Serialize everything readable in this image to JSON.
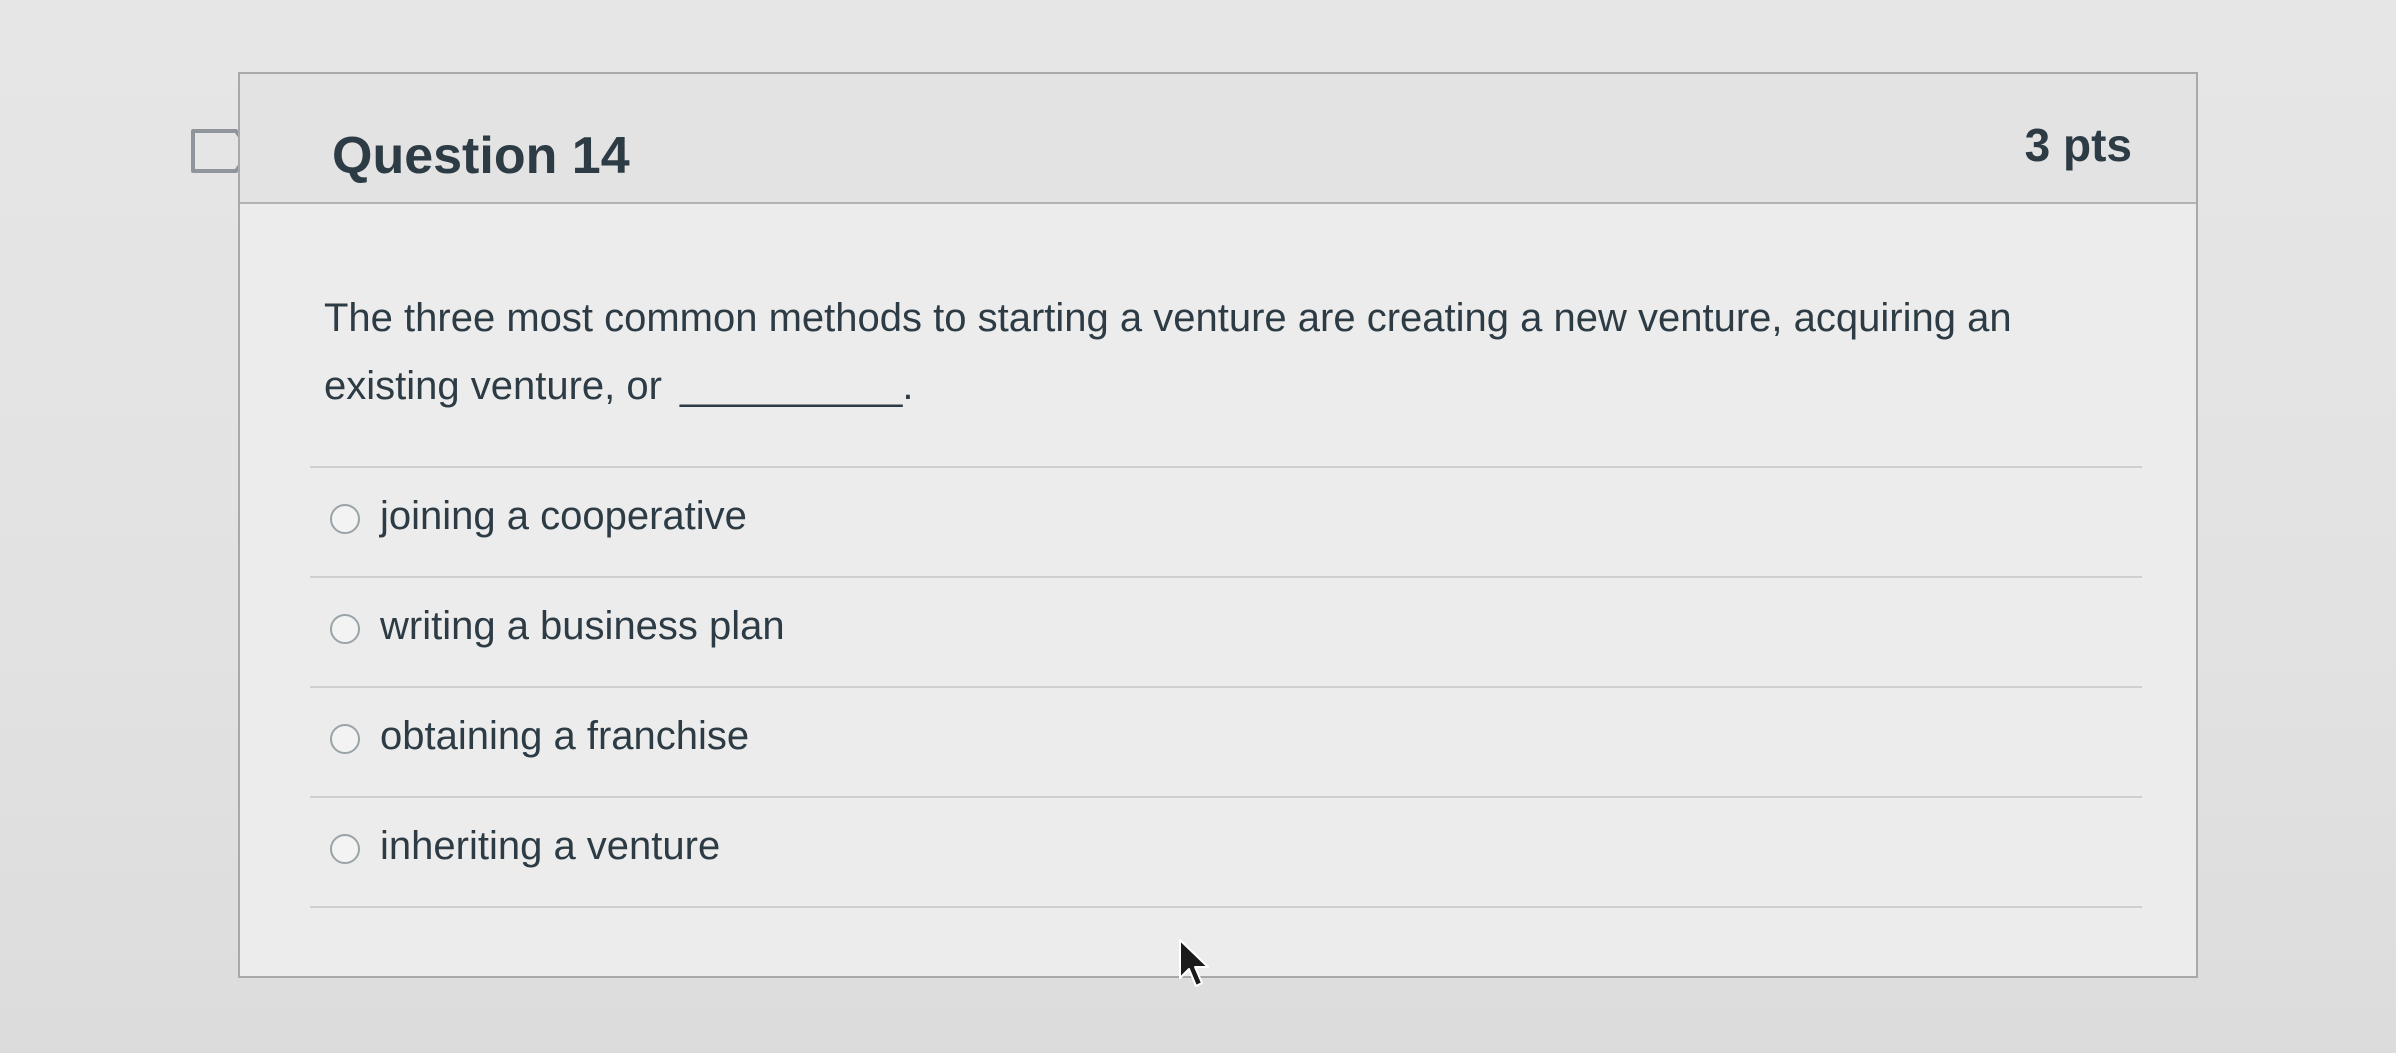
{
  "question": {
    "title": "Question 14",
    "points": "3 pts",
    "text": "The three most common methods to starting a venture are creating a new venture, acquiring an existing venture, or",
    "blank": "__________."
  },
  "answers": [
    {
      "label": "joining a cooperative",
      "selected": false
    },
    {
      "label": "writing a business plan",
      "selected": false
    },
    {
      "label": "obtaining a franchise",
      "selected": false
    },
    {
      "label": "inheriting a venture",
      "selected": false
    }
  ],
  "icons": {
    "flag": "flag-icon",
    "radio": "radio-icon",
    "cursor": "mouse-pointer-icon"
  },
  "colors": {
    "text": "#2d3b45",
    "border": "#a9a9a9",
    "header_bg": "#e3e3e3",
    "card_bg": "#ececec"
  }
}
